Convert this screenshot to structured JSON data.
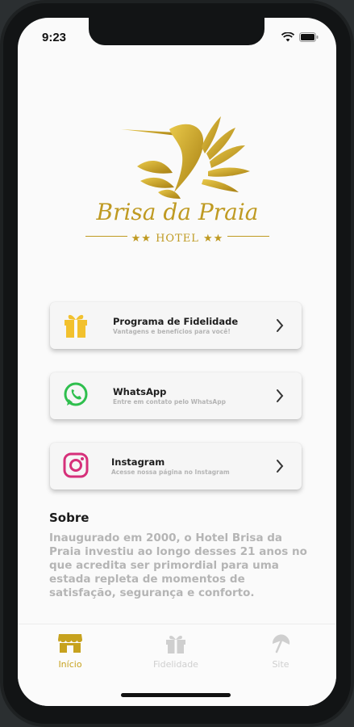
{
  "status_bar": {
    "time": "9:23"
  },
  "logo": {
    "brand_name": "Brisa da Praia",
    "brand_sub": "★★ HOTEL ★★",
    "gold": "#c9a227"
  },
  "cards": [
    {
      "title": "Programa de Fidelidade",
      "subtitle": "Vantagens e benefícios para você!",
      "icon": "gift-icon",
      "icon_color": "#f2c12e"
    },
    {
      "title": "WhatsApp",
      "subtitle": "Entre em contato pelo WhatsApp",
      "icon": "whatsapp-icon",
      "icon_color": "#2fbf4e"
    },
    {
      "title": "Instagram",
      "subtitle": "Acesse nossa página no Instagram",
      "icon": "instagram-icon",
      "icon_color": "#d6307a"
    }
  ],
  "about": {
    "title": "Sobre",
    "text": "Inaugurado em 2000, o Hotel Brisa da Praia investiu ao longo desses 21 anos no que acredita ser primordial para uma estada repleta de momentos de satisfação, segurança e conforto."
  },
  "tabs": [
    {
      "label": "Início",
      "icon": "store-icon",
      "active": true
    },
    {
      "label": "Fidelidade",
      "icon": "gift-icon",
      "active": false
    },
    {
      "label": "Site",
      "icon": "beach-umbrella-icon",
      "active": false
    }
  ],
  "colors": {
    "accent": "#c7a21e",
    "inactive": "#cfcfcf"
  }
}
